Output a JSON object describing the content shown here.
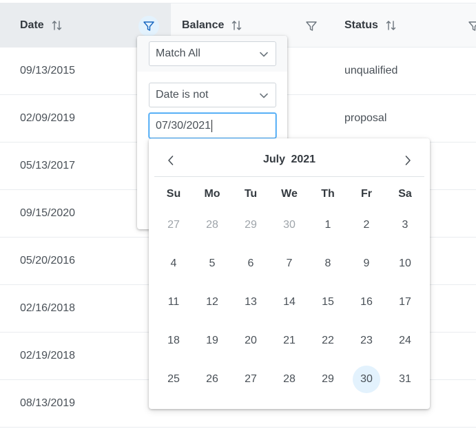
{
  "columns": [
    {
      "label": "Date",
      "sort_icon": "sort-alt-icon",
      "filter_icon": "filter-icon"
    },
    {
      "label": "Balance",
      "sort_icon": "sort-alt-icon",
      "filter_icon": "filter-icon"
    },
    {
      "label": "Status",
      "sort_icon": "sort-alt-icon",
      "filter_icon": "filter-icon"
    }
  ],
  "rows": [
    {
      "date": "09/13/2015",
      "status": "unqualified"
    },
    {
      "date": "02/09/2019",
      "status": "proposal"
    },
    {
      "date": "05/13/2017",
      "status": ""
    },
    {
      "date": "09/15/2020",
      "status": ""
    },
    {
      "date": "05/20/2016",
      "status": ""
    },
    {
      "date": "02/16/2018",
      "status": ""
    },
    {
      "date": "02/19/2018",
      "status": ""
    },
    {
      "date": "08/13/2019",
      "status": ""
    }
  ],
  "filter": {
    "match_mode": "Match All",
    "constraint": "Date is not",
    "value": "07/30/2021"
  },
  "calendar": {
    "month": "July",
    "year": "2021",
    "weekdays": [
      "Su",
      "Mo",
      "Tu",
      "We",
      "Th",
      "Fr",
      "Sa"
    ],
    "weeks": [
      [
        "27",
        "28",
        "29",
        "30",
        "1",
        "2",
        "3"
      ],
      [
        "4",
        "5",
        "6",
        "7",
        "8",
        "9",
        "10"
      ],
      [
        "11",
        "12",
        "13",
        "14",
        "15",
        "16",
        "17"
      ],
      [
        "18",
        "19",
        "20",
        "21",
        "22",
        "23",
        "24"
      ],
      [
        "25",
        "26",
        "27",
        "28",
        "29",
        "30",
        "31"
      ]
    ],
    "other_month_cells": [
      [
        0,
        0
      ],
      [
        0,
        1
      ],
      [
        0,
        2
      ],
      [
        0,
        3
      ]
    ],
    "selected_cell": [
      4,
      5
    ]
  },
  "colors": {
    "accent": "#2196f3",
    "selected_bg": "#e3f2fd"
  }
}
